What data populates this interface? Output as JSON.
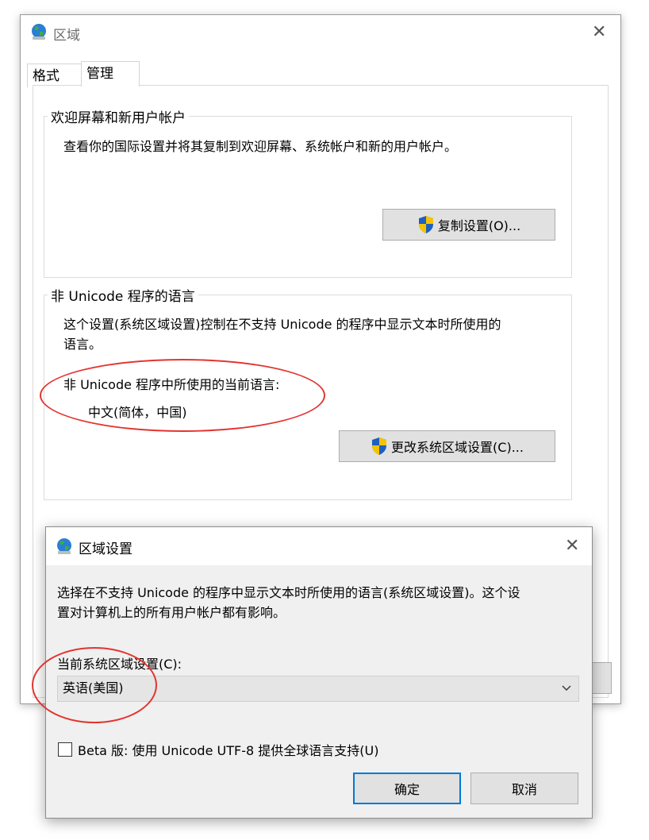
{
  "main_window": {
    "title": "区域",
    "tabs": [
      {
        "label": "格式"
      },
      {
        "label": "管理"
      }
    ],
    "welcome_group": {
      "legend": "欢迎屏幕和新用户帐户",
      "description": "查看你的国际设置并将其复制到欢迎屏幕、系统帐户和新的用户帐户。",
      "copy_button": "复制设置(O)..."
    },
    "unicode_group": {
      "legend": "非 Unicode 程序的语言",
      "description_line1": "这个设置(系统区域设置)控制在不支持 Unicode 的程序中显示文本时所使用的",
      "description_line2": "语言。",
      "current_label": "非 Unicode 程序中所使用的当前语言:",
      "current_value": "中文(简体，中国)",
      "change_button": "更改系统区域设置(C)..."
    }
  },
  "dialog": {
    "title": "区域设置",
    "description_line1": "选择在不支持 Unicode 的程序中显示文本时所使用的语言(系统区域设置)。这个设",
    "description_line2": "置对计算机上的所有用户帐户都有影响。",
    "current_label": "当前系统区域设置(C):",
    "selected_locale": "英语(美国)",
    "beta_checkbox_label": "Beta 版: 使用 Unicode UTF-8 提供全球语言支持(U)",
    "beta_checked": false,
    "ok_button": "确定",
    "cancel_button": "取消"
  },
  "colors": {
    "annotation_red": "#e3342f",
    "primary_button_border": "#0078d7"
  },
  "icons": {
    "title_icon": "globe-icon",
    "button_icon": "uac-shield-icon",
    "close": "close-icon",
    "dropdown": "chevron-down-icon"
  }
}
